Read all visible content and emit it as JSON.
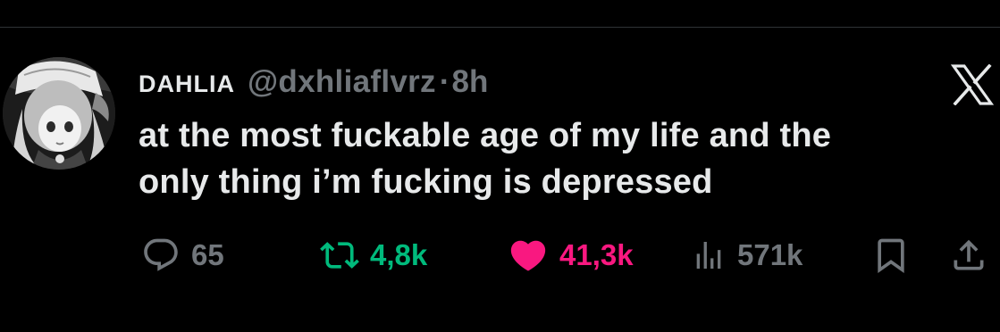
{
  "tweet": {
    "display_name": "DAHLIA",
    "handle": "@dxhliaflvrz",
    "separator": "·",
    "time": "8h",
    "text_lines": [
      "at the most fuckable age of my life and the",
      "only thing i’m fucking is depressed"
    ]
  },
  "actions": {
    "reply": {
      "icon": "reply-icon",
      "count": "65",
      "color": "#71767b"
    },
    "retweet": {
      "icon": "retweet-icon",
      "count": "4,8k",
      "color": "#00ba7c",
      "active": true
    },
    "like": {
      "icon": "heart-icon",
      "count": "41,3k",
      "color": "#f91880",
      "active": true
    },
    "views": {
      "icon": "views-chart-icon",
      "count": "571k",
      "color": "#71767b"
    },
    "bookmark": {
      "icon": "bookmark-icon"
    },
    "share": {
      "icon": "share-icon"
    }
  },
  "brand": {
    "icon": "x-logo-icon"
  },
  "colors": {
    "background": "#000000",
    "text": "#e7e9ea",
    "secondary": "#71767b",
    "retweet_green": "#00ba7c",
    "like_pink": "#f91880"
  }
}
